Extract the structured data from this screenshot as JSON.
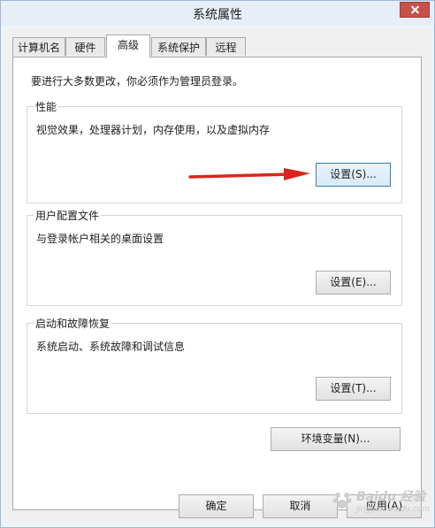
{
  "window": {
    "title": "系统属性",
    "close_icon": "close-icon"
  },
  "tabs": [
    {
      "label": "计算机名",
      "active": false
    },
    {
      "label": "硬件",
      "active": false
    },
    {
      "label": "高级",
      "active": true
    },
    {
      "label": "系统保护",
      "active": false
    },
    {
      "label": "远程",
      "active": false
    }
  ],
  "advanced": {
    "admin_notice": "要进行大多数更改，你必须作为管理员登录。",
    "performance": {
      "title": "性能",
      "description": "视觉效果，处理器计划，内存使用，以及虚拟内存",
      "button": "设置(S)..."
    },
    "user_profiles": {
      "title": "用户配置文件",
      "description": "与登录帐户相关的桌面设置",
      "button": "设置(E)..."
    },
    "startup_recovery": {
      "title": "启动和故障恢复",
      "description": "系统启动、系统故障和调试信息",
      "button": "设置(T)..."
    },
    "env_button": "环境变量(N)..."
  },
  "footer": {
    "ok": "确定",
    "cancel": "取消",
    "apply": "应用(A)"
  },
  "annotation": {
    "arrow_color": "#d9261c"
  },
  "watermark": {
    "text": "Baidu 经验",
    "sub": "jingyan.baidu.com"
  }
}
